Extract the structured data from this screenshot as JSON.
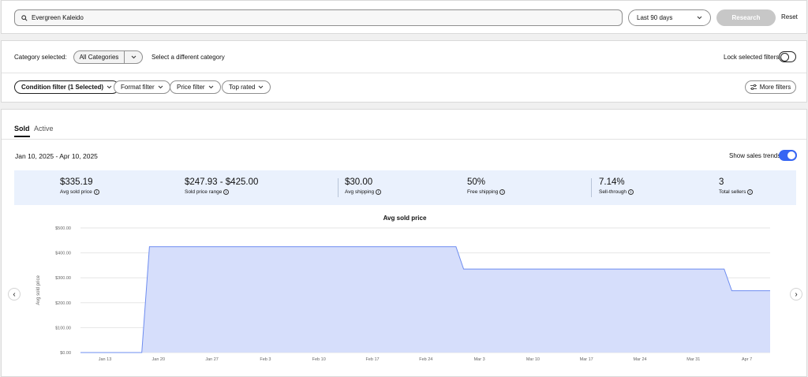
{
  "search": {
    "query": "Evergreen Kaleido",
    "range": "Last 90 days",
    "research_label": "Research",
    "reset_label": "Reset"
  },
  "category": {
    "label": "Category selected:",
    "selected": "All Categories",
    "alt_link": "Select a different category",
    "lock_label": "Lock selected filters"
  },
  "filters": [
    {
      "label": "Condition filter (1 Selected)"
    },
    {
      "label": "Format filter"
    },
    {
      "label": "Price filter"
    },
    {
      "label": "Top rated"
    }
  ],
  "more_filters": "More filters",
  "tabs": {
    "sold": "Sold",
    "active": "Active"
  },
  "date_range": "Jan 10, 2025 - Apr 10, 2025",
  "trends_label": "Show sales trends",
  "stats": [
    {
      "value": "$335.19",
      "label": "Avg sold price"
    },
    {
      "value": "$247.93 - $425.00",
      "label": "Sold price range"
    },
    {
      "value": "$30.00",
      "label": "Avg shipping"
    },
    {
      "value": "50%",
      "label": "Free shipping"
    },
    {
      "value": "7.14%",
      "label": "Sell-through"
    },
    {
      "value": "3",
      "label": "Total sellers"
    }
  ],
  "colors": {
    "accent": "#3665f3",
    "area_fill": "#d6defb",
    "area_stroke": "#6d8cf0",
    "stats_bg": "#eaf1fd"
  },
  "chart_data": {
    "type": "area",
    "title": "Avg sold price",
    "ylabel": "Avg sold price",
    "ylim": [
      0,
      500
    ],
    "yticks": [
      "$0.00",
      "$100.00",
      "$200.00",
      "$300.00",
      "$400.00",
      "$500.00"
    ],
    "x_ticks": [
      "Jan 13",
      "Jan 20",
      "Jan 27",
      "Feb 3",
      "Feb 10",
      "Feb 17",
      "Feb 24",
      "Mar 3",
      "Mar 10",
      "Mar 17",
      "Mar 24",
      "Mar 31",
      "Apr 7"
    ],
    "grid": true,
    "series": [
      {
        "points": [
          {
            "x": "2025-01-10",
            "y": 0
          },
          {
            "x": "2025-01-18",
            "y": 0
          },
          {
            "x": "2025-01-19",
            "y": 425
          },
          {
            "x": "2025-02-28",
            "y": 425
          },
          {
            "x": "2025-03-01",
            "y": 335
          },
          {
            "x": "2025-04-04",
            "y": 335
          },
          {
            "x": "2025-04-05",
            "y": 248
          },
          {
            "x": "2025-04-10",
            "y": 248
          }
        ]
      }
    ]
  }
}
